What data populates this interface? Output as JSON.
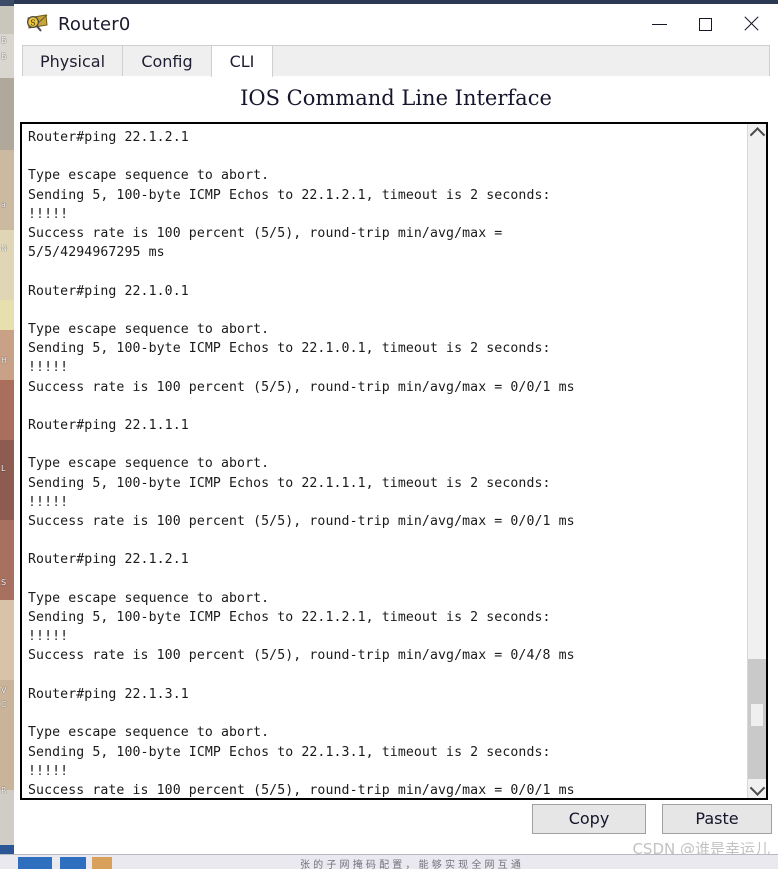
{
  "window": {
    "title": "Router0",
    "icon": "packet-tracer-router-icon",
    "controls": {
      "minimize": "minimize-icon",
      "maximize": "maximize-icon",
      "close": "close-icon"
    }
  },
  "tabs": [
    {
      "label": "Physical",
      "active": false
    },
    {
      "label": "Config",
      "active": false
    },
    {
      "label": "CLI",
      "active": true
    }
  ],
  "heading": "IOS Command Line Interface",
  "terminal": {
    "content": "Router#ping 22.1.2.1\n\nType escape sequence to abort.\nSending 5, 100-byte ICMP Echos to 22.1.2.1, timeout is 2 seconds:\n!!!!!\nSuccess rate is 100 percent (5/5), round-trip min/avg/max =\n5/5/4294967295 ms\n\nRouter#ping 22.1.0.1\n\nType escape sequence to abort.\nSending 5, 100-byte ICMP Echos to 22.1.0.1, timeout is 2 seconds:\n!!!!!\nSuccess rate is 100 percent (5/5), round-trip min/avg/max = 0/0/1 ms\n\nRouter#ping 22.1.1.1\n\nType escape sequence to abort.\nSending 5, 100-byte ICMP Echos to 22.1.1.1, timeout is 2 seconds:\n!!!!!\nSuccess rate is 100 percent (5/5), round-trip min/avg/max = 0/0/1 ms\n\nRouter#ping 22.1.2.1\n\nType escape sequence to abort.\nSending 5, 100-byte ICMP Echos to 22.1.2.1, timeout is 2 seconds:\n!!!!!\nSuccess rate is 100 percent (5/5), round-trip min/avg/max = 0/4/8 ms\n\nRouter#ping 22.1.3.1\n\nType escape sequence to abort.\nSending 5, 100-byte ICMP Echos to 22.1.3.1, timeout is 2 seconds:\n!!!!!\nSuccess rate is 100 percent (5/5), round-trip min/avg/max = 0/0/1 ms\n\nRouter#",
    "prompt": "Router#",
    "scrollbar": {
      "up_arrow": "chevron-up-icon",
      "down_arrow": "chevron-down-icon"
    }
  },
  "buttons": {
    "copy": "Copy",
    "paste": "Paste"
  },
  "watermark": "CSDN @谁是幸运儿",
  "desktop": {
    "side_labels": [
      "B",
      "B",
      "a",
      "N",
      "H",
      "L",
      "S",
      "V",
      "C",
      "R"
    ]
  },
  "taskbar": {
    "text": "张 的 子 网 掩 码 配 置 ， 能 够 实 现 全 网 互 通"
  },
  "colors": {
    "titlebar_accent": "#2b3a52",
    "tab_active_bg": "#ffffff",
    "tab_inactive_bg": "#efefef",
    "terminal_bg": "#ffffff",
    "terminal_fg": "#1a1a1a",
    "button_bg": "#e6e6e6",
    "watermark_fg": "#c2c2c2"
  }
}
